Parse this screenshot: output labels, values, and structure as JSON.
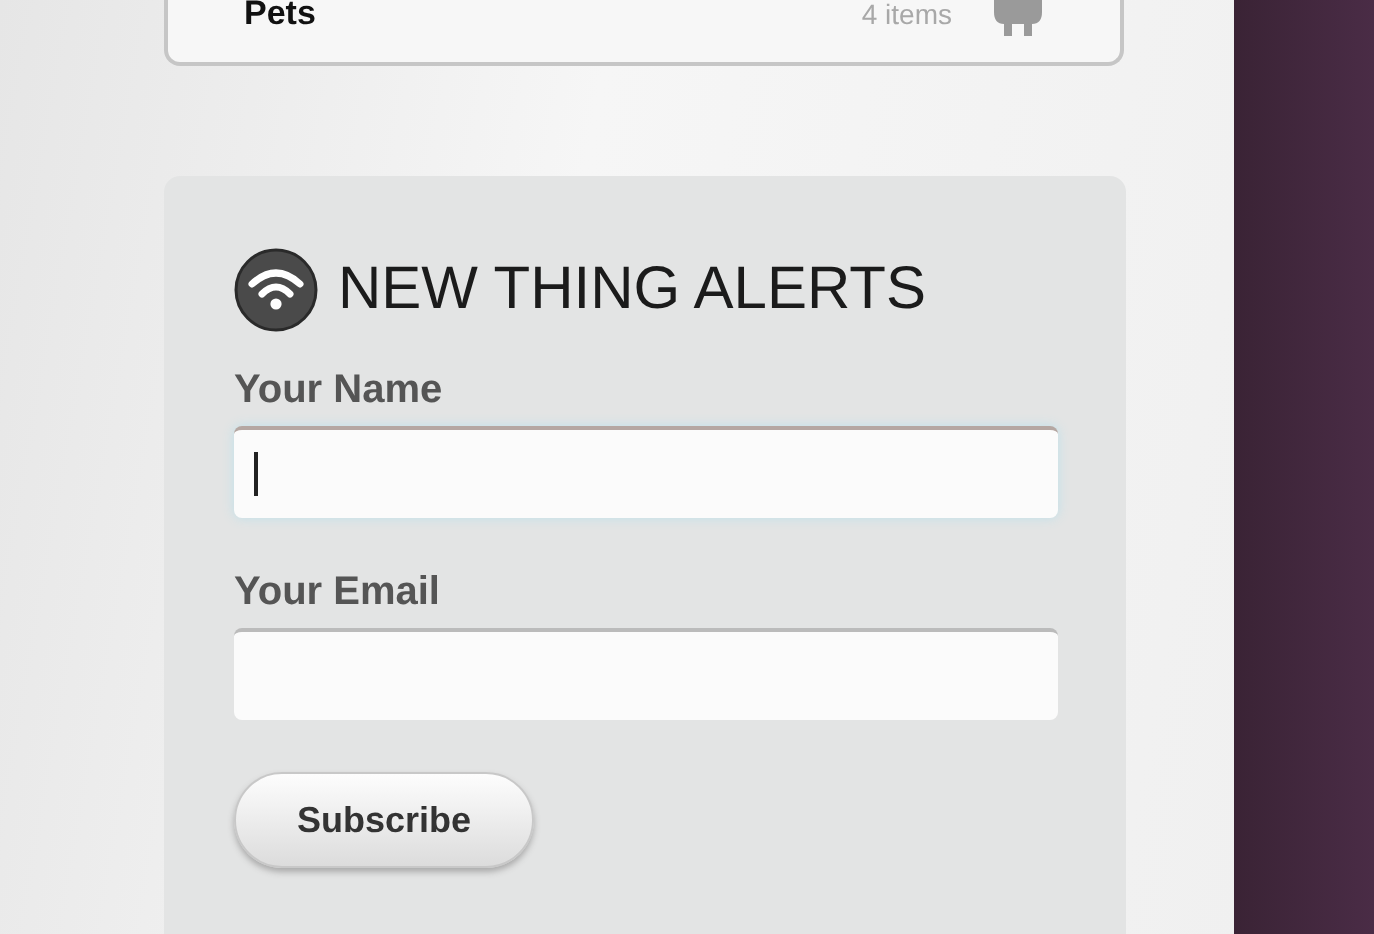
{
  "category": {
    "name": "Pets",
    "count": "4 items"
  },
  "alerts": {
    "title": "NEW THING ALERTS",
    "fields": [
      {
        "label": "Your Name",
        "focused": true
      },
      {
        "label": "Your Email",
        "focused": false
      }
    ],
    "button": "Subscribe"
  }
}
